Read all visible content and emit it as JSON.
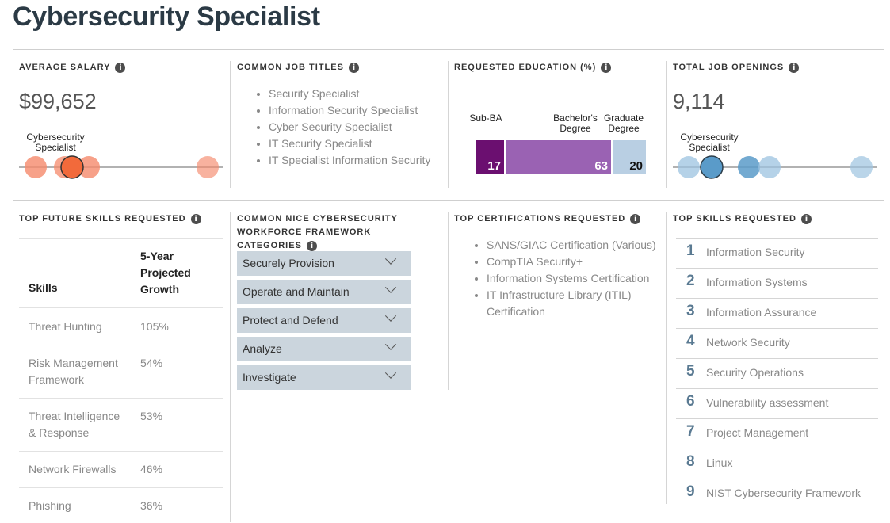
{
  "page_title": "Cybersecurity Specialist",
  "info_glyph": "i",
  "average_salary": {
    "heading": "AVERAGE SALARY",
    "value": "$99,652",
    "marker_label": "Cybersecurity Specialist",
    "colors": {
      "dot": "#f5896b",
      "highlight": "#f26a3b"
    }
  },
  "common_job_titles": {
    "heading": "COMMON JOB TITLES",
    "items": [
      "Security Specialist",
      "Information Security Specialist",
      "Cyber Security Specialist",
      "IT Security Specialist",
      "IT Specialist Information Security"
    ]
  },
  "requested_education": {
    "heading": "REQUESTED EDUCATION (%)",
    "chart_data": {
      "type": "bar",
      "categories": [
        "Sub-BA",
        "Bachelor's Degree",
        "Graduate Degree"
      ],
      "values": [
        17,
        63,
        20
      ],
      "colors": [
        "#6b0f70",
        "#9a62b3",
        "#b9cfe3"
      ]
    }
  },
  "total_job_openings": {
    "heading": "TOTAL JOB OPENINGS",
    "value": "9,114",
    "marker_label": "Cybersecurity Specialist",
    "colors": {
      "dot": "#9cc3e0",
      "highlight": "#5a9bc9"
    }
  },
  "top_future_skills": {
    "heading": "TOP FUTURE SKILLS REQUESTED",
    "col_skills": "Skills",
    "col_growth": "5-Year Projected Growth",
    "rows": [
      {
        "skill": "Threat Hunting",
        "growth": "105%"
      },
      {
        "skill": "Risk Management Framework",
        "growth": "54%"
      },
      {
        "skill": "Threat Intelligence & Response",
        "growth": "53%"
      },
      {
        "skill": "Network Firewalls",
        "growth": "46%"
      },
      {
        "skill": "Phishing",
        "growth": "36%"
      }
    ]
  },
  "nice_framework": {
    "heading": "COMMON NICE CYBERSECURITY WORKFORCE FRAMEWORK CATEGORIES",
    "items": [
      "Securely Provision",
      "Operate and Maintain",
      "Protect and Defend",
      "Analyze",
      "Investigate"
    ]
  },
  "top_certifications": {
    "heading": "TOP CERTIFICATIONS REQUESTED",
    "items": [
      "SANS/GIAC Certification (Various)",
      "CompTIA Security+",
      "Information Systems Certification",
      "IT Infrastructure Library (ITIL) Certification"
    ]
  },
  "top_skills": {
    "heading": "TOP SKILLS REQUESTED",
    "items": [
      {
        "rank": "1",
        "label": "Information Security"
      },
      {
        "rank": "2",
        "label": "Information Systems"
      },
      {
        "rank": "3",
        "label": "Information Assurance"
      },
      {
        "rank": "4",
        "label": "Network Security"
      },
      {
        "rank": "5",
        "label": "Security Operations"
      },
      {
        "rank": "6",
        "label": "Vulnerability assessment"
      },
      {
        "rank": "7",
        "label": "Project Management"
      },
      {
        "rank": "8",
        "label": "Linux"
      },
      {
        "rank": "9",
        "label": "NIST Cybersecurity Framework"
      }
    ]
  }
}
